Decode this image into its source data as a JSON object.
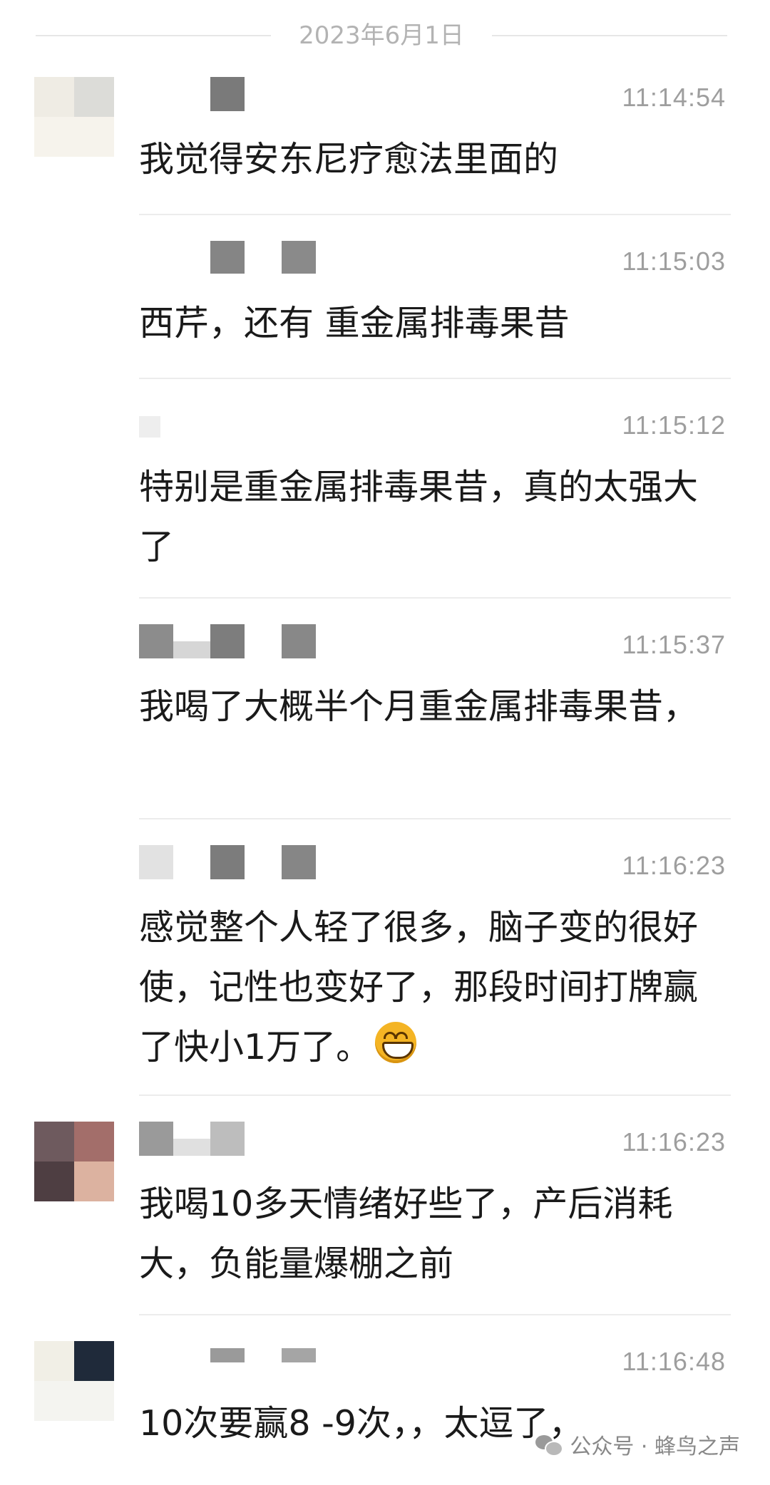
{
  "date_separator": "2023年6月1日",
  "messages": [
    {
      "time": "11:14:54",
      "text": "我觉得安东尼疗愈法里面的",
      "has_avatar": true
    },
    {
      "time": "11:15:03",
      "text": "西芹，还有 重金属排毒果昔",
      "has_avatar": false
    },
    {
      "time": "11:15:12",
      "text": "特别是重金属排毒果昔，真的太强大了",
      "has_avatar": false
    },
    {
      "time": "11:15:37",
      "text": "我喝了大概半个月重金属排毒果昔，",
      "has_avatar": false
    },
    {
      "time": "11:16:23",
      "text": "感觉整个人轻了很多，脑子变的很好使，记性也变好了，那段时间打牌赢了快小1万了。",
      "emoji": "grinning-face-icon",
      "has_avatar": false
    },
    {
      "time": "11:16:23",
      "text": "我喝10多天情绪好些了，产后消耗大，负能量爆棚之前",
      "has_avatar": true
    },
    {
      "time": "11:16:48",
      "text": "10次要赢8 -9次，，太逗了，",
      "has_avatar": true
    }
  ],
  "watermark": {
    "label": "公众号 · 蜂鸟之声",
    "icon": "wechat-icon"
  }
}
